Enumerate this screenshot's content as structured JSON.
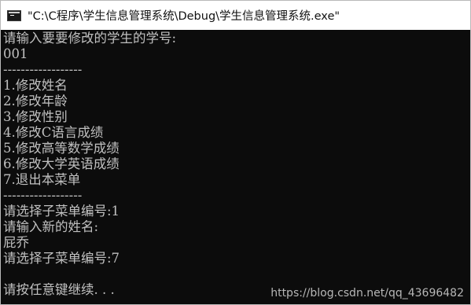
{
  "window": {
    "title": "\"C:\\C程序\\学生信息管理系统\\Debug\\学生信息管理系统.exe\""
  },
  "console": {
    "lines": [
      "请输入要要修改的学生的学号:",
      "001",
      "------------------",
      "1.修改姓名",
      "2.修改年龄",
      "3.修改性别",
      "4.修改C语言成绩",
      "5.修改高等数学成绩",
      "6.修改大学英语成绩",
      "7.退出本菜单",
      "------------------",
      "请选择子菜单编号:1",
      "请输入新的姓名:",
      "屁乔",
      "请选择子菜单编号:7",
      "",
      "请按任意键继续. . ."
    ]
  },
  "watermark": "https://blog.csdn.net/qq_43696482"
}
